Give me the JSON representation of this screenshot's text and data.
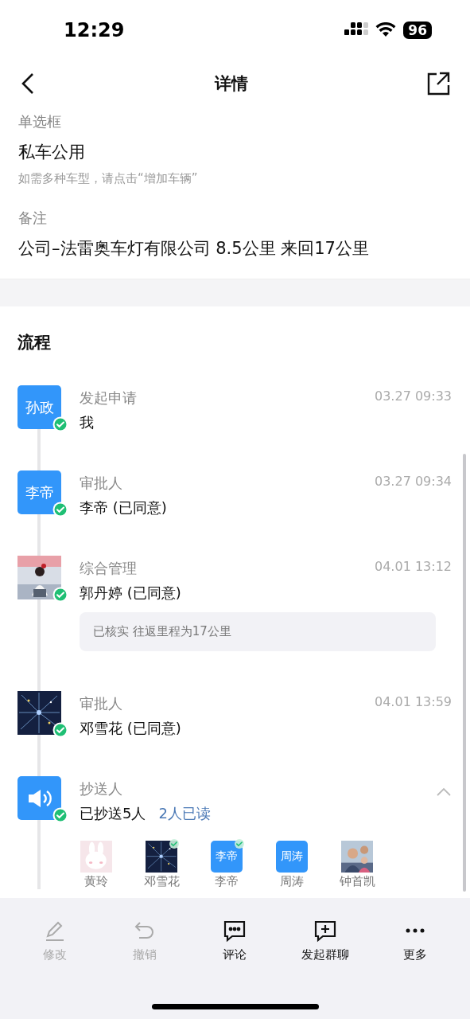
{
  "status_bar": {
    "time": "12:29",
    "battery": "96"
  },
  "nav": {
    "title": "详情"
  },
  "fields": [
    {
      "label": "单选框",
      "value": "私车公用",
      "hint": "如需多种车型，请点击“增加车辆”"
    },
    {
      "label": "备注",
      "value": "公司–法雷奥车灯有限公司 8.5公里 来回17公里"
    }
  ],
  "process": {
    "title": "流程",
    "steps": [
      {
        "avatar": {
          "kind": "text",
          "text": "孙政"
        },
        "done": true,
        "role": "发起申请",
        "person": "我",
        "time": "03.27 09:33"
      },
      {
        "avatar": {
          "kind": "text",
          "text": "李帝"
        },
        "done": true,
        "role": "审批人",
        "person": "李帝 (已同意)",
        "time": "03.27 09:34"
      },
      {
        "done": true,
        "role": "综合管理",
        "person": "郭丹婷 (已同意)",
        "time": "04.01 13:12",
        "comment": "已核实 往返里程为17公里"
      },
      {
        "done": true,
        "role": "审批人",
        "person": "邓雪花 (已同意)",
        "time": "04.01 13:59"
      },
      {
        "avatar": {
          "kind": "icon"
        },
        "done": true,
        "role": "抄送人",
        "person": "已抄送5人",
        "read_count": "2人已读",
        "expanded": true,
        "recipients": [
          {
            "name": "黄玲",
            "read": false
          },
          {
            "name": "邓雪花",
            "read": true
          },
          {
            "name": "李帝",
            "avatar": {
              "kind": "text",
              "text": "李帝"
            },
            "read": true
          },
          {
            "name": "周涛",
            "avatar": {
              "kind": "text",
              "text": "周涛"
            },
            "read": false
          },
          {
            "name": "钟首凯",
            "read": false
          }
        ]
      }
    ]
  },
  "toolbar": [
    {
      "label": "修改",
      "disabled": true
    },
    {
      "label": "撤销",
      "disabled": true
    },
    {
      "label": "评论",
      "disabled": false
    },
    {
      "label": "发起群聊",
      "disabled": false
    },
    {
      "label": "更多",
      "disabled": false
    }
  ]
}
